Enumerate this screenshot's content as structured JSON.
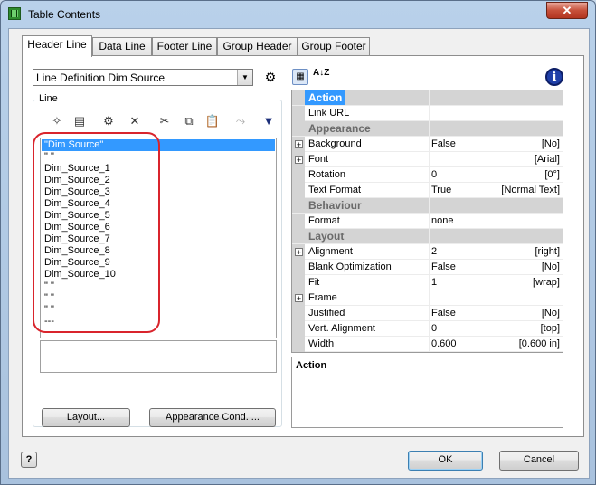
{
  "window": {
    "title": "Table Contents",
    "close_glyph": "✕"
  },
  "tabs": [
    {
      "label": "Header Line",
      "active": true
    },
    {
      "label": "Data Line",
      "active": false
    },
    {
      "label": "Footer Line",
      "active": false
    },
    {
      "label": "Group Header",
      "active": false
    },
    {
      "label": "Group Footer",
      "active": false
    }
  ],
  "line_definition": {
    "selected": "Line Definition Dim Source"
  },
  "line_group": {
    "legend": "Line",
    "toolbar": [
      {
        "name": "new-line-icon",
        "glyph": "✧"
      },
      {
        "name": "insert-line-icon",
        "glyph": "▤"
      },
      {
        "name": "properties-icon",
        "glyph": "⚙"
      },
      {
        "name": "delete-icon",
        "glyph": "✕"
      },
      {
        "name": "cut-icon",
        "glyph": "✂"
      },
      {
        "name": "copy-icon",
        "glyph": "⧉"
      },
      {
        "name": "paste-icon",
        "glyph": "📋"
      },
      {
        "name": "disabled-icon",
        "glyph": "⤳"
      },
      {
        "name": "move-down-icon",
        "glyph": "▼"
      }
    ],
    "items": [
      "\"Dim Source\"",
      "\" \"",
      "Dim_Source_1",
      "Dim_Source_2",
      "Dim_Source_3",
      "Dim_Source_4",
      "Dim_Source_5",
      "Dim_Source_6",
      "Dim_Source_7",
      "Dim_Source_8",
      "Dim_Source_9",
      "Dim_Source_10",
      "\" \"",
      "\" \"",
      "\" \"",
      "---"
    ],
    "selected_index": 0,
    "layout_button": "Layout...",
    "appearance_button": "Appearance Cond. ..."
  },
  "property_grid": {
    "rows": [
      {
        "type": "category",
        "label": "Action"
      },
      {
        "type": "prop",
        "name": "Link URL",
        "value": "",
        "unit": "",
        "expandable": false,
        "selected": false
      },
      {
        "type": "category",
        "label": "Appearance"
      },
      {
        "type": "prop",
        "name": "Background",
        "value": "False",
        "unit": "[No]",
        "expandable": true,
        "selected": false
      },
      {
        "type": "prop",
        "name": "Font",
        "value": "",
        "unit": "[Arial]",
        "expandable": true,
        "selected": false
      },
      {
        "type": "prop",
        "name": "Rotation",
        "value": "0",
        "unit": "[0°]",
        "expandable": false,
        "selected": false
      },
      {
        "type": "prop",
        "name": "Text Format",
        "value": "True",
        "unit": "[Normal Text]",
        "expandable": false,
        "selected": false
      },
      {
        "type": "category",
        "label": "Behaviour"
      },
      {
        "type": "prop",
        "name": "Format",
        "value": "none",
        "unit": "",
        "expandable": false,
        "selected": false
      },
      {
        "type": "category",
        "label": "Layout"
      },
      {
        "type": "prop",
        "name": "Alignment",
        "value": "2",
        "unit": "[right]",
        "expandable": true,
        "selected": false
      },
      {
        "type": "prop",
        "name": "Blank Optimization",
        "value": "False",
        "unit": "[No]",
        "expandable": false,
        "selected": false
      },
      {
        "type": "prop",
        "name": "Fit",
        "value": "1",
        "unit": "[wrap]",
        "expandable": false,
        "selected": false
      },
      {
        "type": "prop",
        "name": "Frame",
        "value": "",
        "unit": "",
        "expandable": true,
        "selected": false
      },
      {
        "type": "prop",
        "name": "Justified",
        "value": "False",
        "unit": "[No]",
        "expandable": false,
        "selected": false
      },
      {
        "type": "prop",
        "name": "Vert. Alignment",
        "value": "0",
        "unit": "[top]",
        "expandable": false,
        "selected": false
      },
      {
        "type": "prop",
        "name": "Width",
        "value": "0.600",
        "unit": "[0.600 in]",
        "expandable": false,
        "selected": false
      }
    ],
    "description_title": "Action",
    "info_glyph": "i",
    "sort_glyph": "A↓Z"
  },
  "footer": {
    "help_glyph": "?",
    "ok_label": "OK",
    "cancel_label": "Cancel"
  },
  "colors": {
    "selection": "#3399ff",
    "highlight_oval": "#d9242c",
    "category_bg": "#d4d4d4"
  }
}
